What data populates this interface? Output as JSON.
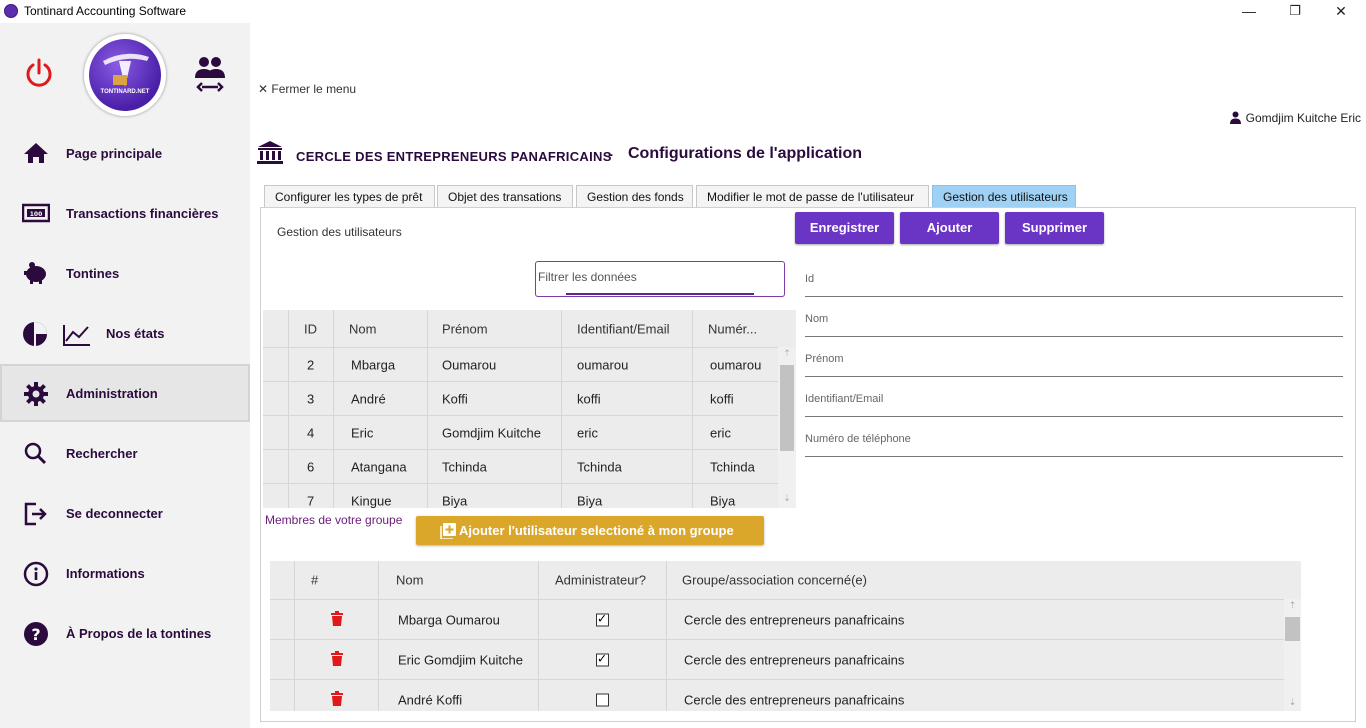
{
  "window": {
    "title": "Tontinard Accounting Software",
    "minimize": "—",
    "maximize": "❐",
    "close": "✕"
  },
  "logo": {
    "text": "TONTINARD.NET"
  },
  "sidebar": {
    "items": [
      {
        "label": "Page principale",
        "icon": "home-icon"
      },
      {
        "label": "Transactions financières",
        "icon": "cash-icon"
      },
      {
        "label": "Tontines",
        "icon": "piggy-bank-icon"
      },
      {
        "label": "Nos états",
        "icon": "chart-icon"
      },
      {
        "label": "Administration",
        "icon": "gear-icon",
        "active": true
      },
      {
        "label": "Rechercher",
        "icon": "search-icon"
      },
      {
        "label": "Se deconnecter",
        "icon": "logout-icon"
      },
      {
        "label": "Informations",
        "icon": "info-icon"
      },
      {
        "label": "À Propos de la  tontines",
        "icon": "help-icon"
      }
    ]
  },
  "header": {
    "close_menu": "✕ Fermer le menu",
    "user_name": "Gomdjim Kuitche Eric",
    "org_name": "CERCLE DES ENTREPRENEURS PANAFRICAINS",
    "separator": "-",
    "page_title": "Configurations de l'application"
  },
  "tabs": [
    "Configurer les types de prêt",
    "Objet des transations",
    "Gestion des fonds",
    "Modifier le mot de passe de l'utilisateur",
    "Gestion des utilisateurs"
  ],
  "section_label": "Gestion des utilisateurs",
  "buttons": {
    "save": "Enregistrer",
    "add": "Ajouter",
    "delete": "Supprimer",
    "add_to_group": "Ajouter l'utilisateur selectioné à mon groupe"
  },
  "filter": {
    "placeholder": "Filtrer les données"
  },
  "users_table": {
    "headers": [
      "ID",
      "Nom",
      "Prénom",
      "Identifiant/Email",
      "Numér..."
    ],
    "rows": [
      [
        "2",
        "Mbarga",
        "Oumarou",
        "oumarou",
        "oumarou"
      ],
      [
        "3",
        "André",
        "Koffi",
        "koffi",
        "koffi"
      ],
      [
        "4",
        "Eric",
        "Gomdjim Kuitche",
        "eric",
        "eric"
      ],
      [
        "6",
        "Atangana",
        "Tchinda",
        "Tchinda",
        "Tchinda"
      ],
      [
        "7",
        "Kingue",
        "Biya",
        "Biya",
        "Biya"
      ]
    ]
  },
  "form": {
    "id": "Id",
    "nom": "Nom",
    "prenom": "Prénom",
    "identifiant": "Identifiant/Email",
    "telephone": "Numéro de téléphone"
  },
  "members_label": "Membres de votre groupe",
  "members_table": {
    "headers": [
      "#",
      "Nom",
      "Administrateur?",
      "Groupe/association concerné(e)"
    ],
    "rows": [
      {
        "name": "Mbarga Oumarou",
        "admin": true,
        "group": "Cercle des entrepreneurs panafricains"
      },
      {
        "name": "Eric Gomdjim Kuitche",
        "admin": true,
        "group": "Cercle des entrepreneurs panafricains"
      },
      {
        "name": "André Koffi",
        "admin": false,
        "group": "Cercle des entrepreneurs panafricains"
      }
    ]
  },
  "colors": {
    "primary": "#6a35c4",
    "accent_gold": "#dba72a",
    "power_red": "#e0191b",
    "delete_red": "#e0191b",
    "nav_text": "#2b0a3d",
    "active_tab": "#9fd1f5"
  }
}
